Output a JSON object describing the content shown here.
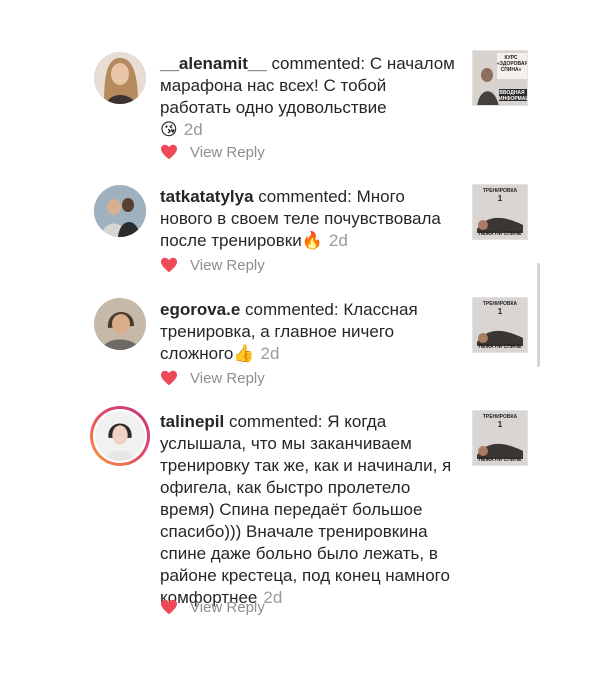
{
  "comments": [
    {
      "username": "__alenamit__",
      "verb": "commented:",
      "text": "С началом марафона нас всех! С тобой работать одно удовольствие",
      "emoji": "😘",
      "time": "2d",
      "reply_label": "View Reply",
      "avatar_icon": "woman-portrait-icon",
      "thumb": {
        "lines": [
          "КУРС",
          "«ЗДОРОВАЯ",
          "СПИНА»",
          "ВВОДНАЯ",
          "ИНФОРМАЦИЯ"
        ]
      }
    },
    {
      "username": "tatkatatylya",
      "verb": "commented:",
      "text": "Много нового в своем теле почувствовала после тренировки",
      "emoji": "🔥",
      "time": "2d",
      "reply_label": "View Reply",
      "avatar_icon": "people-photo-icon",
      "thumb": {
        "top": "ТРЕНИРОВКА",
        "num": "1",
        "bottom": "ЛЁЖА НА СПИНЕ"
      }
    },
    {
      "username": "egorova.e",
      "verb": "commented:",
      "text": "Классная тренировка, а главное ничего сложного",
      "emoji": "👍",
      "time": "2d",
      "reply_label": "View Reply",
      "avatar_icon": "woman-portrait-icon",
      "thumb": {
        "top": "ТРЕНИРОВКА",
        "num": "1",
        "bottom": "ЛЁЖА НА СПИНЕ"
      }
    },
    {
      "username": "talinepil",
      "verb": "commented:",
      "text": "Я когда услышала, что мы заканчиваем тренировку так же, как и начинали, я офигела, как быстро пролетело время) Спина передаёт большое спасибо))) Вначале тренировкина спине даже больно было лежать, в районе крестеца, под конец намного комфортнее",
      "emoji": "",
      "time": "2d",
      "reply_label": "View Reply",
      "avatar_icon": "woman-portrait-icon",
      "thumb": {
        "top": "ТРЕНИРОВКА",
        "num": "1",
        "bottom": "ЛЁЖА НА СПИНЕ"
      }
    }
  ],
  "colors": {
    "heart": "#ed4956",
    "muted": "#8e8e8e",
    "text": "#262626"
  }
}
